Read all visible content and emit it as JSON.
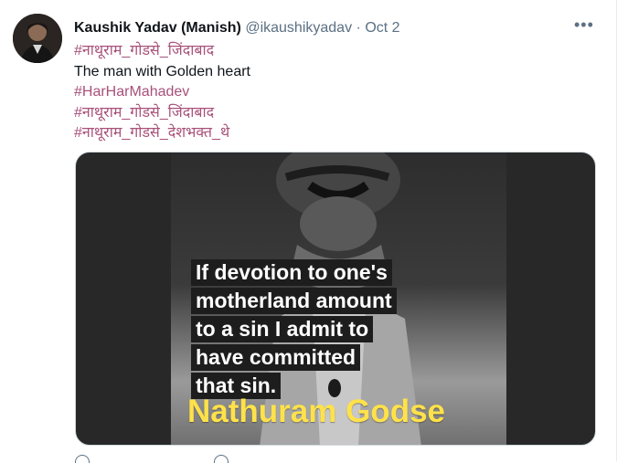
{
  "tweet": {
    "author_name": "Kaushik Yadav (Manish)",
    "handle": "@ikaushikyadav",
    "separator": "·",
    "date": "Oct 2",
    "more_icon": "more-icon",
    "avatar_icon": "avatar",
    "lines": [
      {
        "text": "#नाथूराम_गोडसे_जिंदाबाद",
        "kind": "hashtag"
      },
      {
        "text": "The man with Golden heart",
        "kind": "plain"
      },
      {
        "text": "#HarHarMahadev",
        "kind": "hashtag"
      },
      {
        "text": "#नाथूराम_गोडसे_जिंदाबाद",
        "kind": "hashtag"
      },
      {
        "text": "#नाथूराम_गोडसे_देशभक्त_थे",
        "kind": "hashtag"
      }
    ]
  },
  "media": {
    "quote_lines": [
      "If devotion to one's",
      "motherland amount",
      "to a sin I admit to",
      "have committed",
      "that sin."
    ],
    "author": "Nathuram Godse",
    "colors": {
      "caption_yellow": "#ffe24a",
      "hashtag_color": "#a8517a"
    }
  }
}
